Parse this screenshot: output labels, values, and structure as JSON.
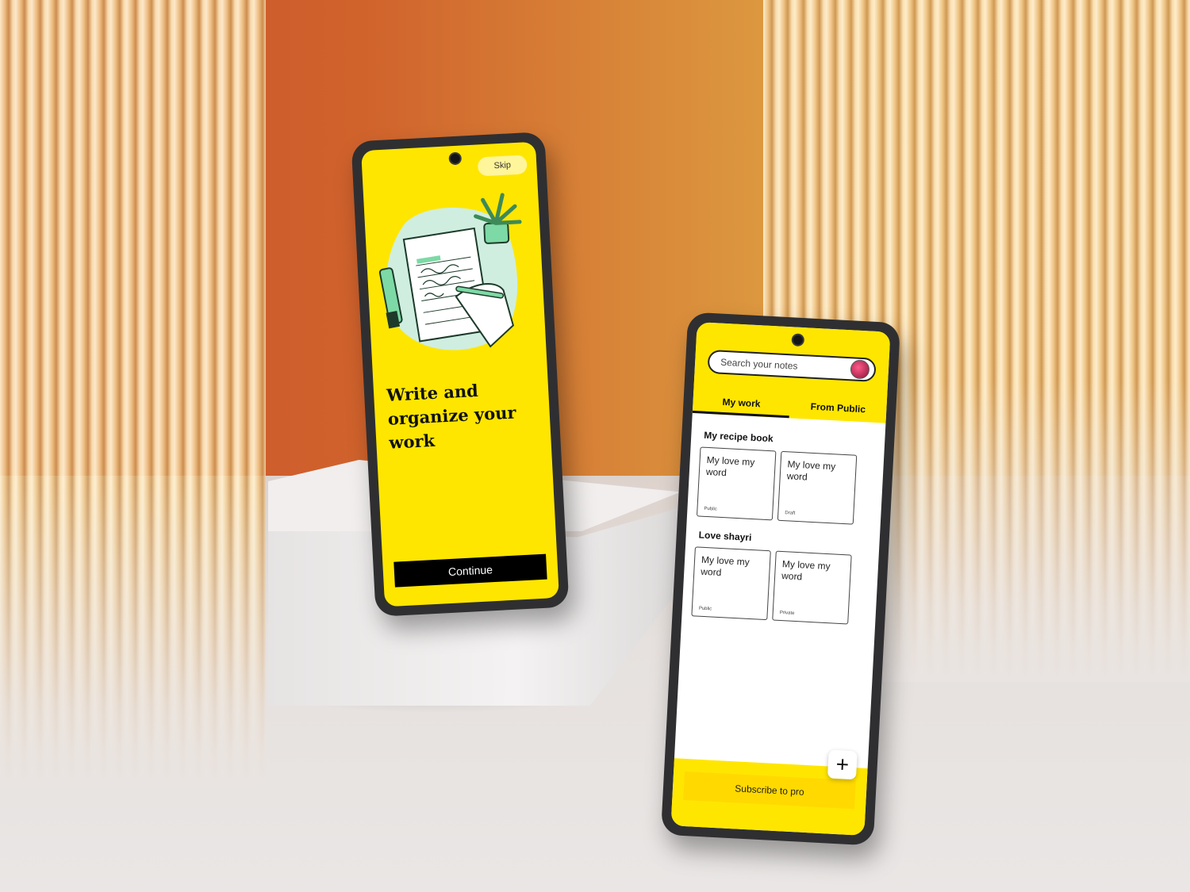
{
  "onboarding": {
    "skip_label": "Skip",
    "headline": "Write and organize your work",
    "continue_label": "Continue"
  },
  "notes_app": {
    "search": {
      "placeholder": "Search your notes"
    },
    "tabs": [
      {
        "label": "My work",
        "active": true
      },
      {
        "label": "From Public",
        "active": false
      }
    ],
    "sections": [
      {
        "title": "My recipe book",
        "cards": [
          {
            "title": "My love my word",
            "tag": "Public"
          },
          {
            "title": "My love my word",
            "tag": "Draft"
          }
        ]
      },
      {
        "title": "Love shayri",
        "cards": [
          {
            "title": "My love my word",
            "tag": "Public"
          },
          {
            "title": "My love my word",
            "tag": "Private"
          }
        ]
      }
    ],
    "fab_icon": "plus-icon",
    "subscribe_label": "Subscribe to pro"
  },
  "colors": {
    "brand_yellow": "#ffe600",
    "primary_button": "#000000"
  }
}
